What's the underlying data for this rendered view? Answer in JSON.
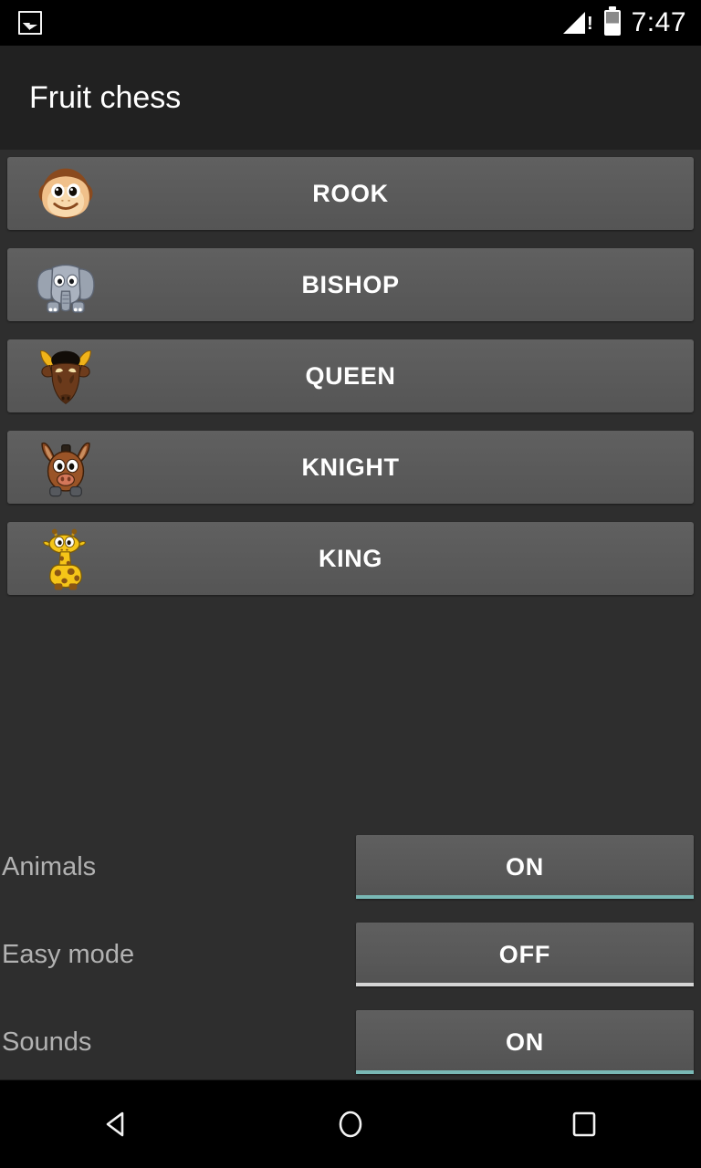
{
  "status_bar": {
    "notification_icon": "photo-icon",
    "signal_icon": "signal-no-sim-icon",
    "battery_icon": "battery-icon",
    "time": "7:47"
  },
  "header": {
    "title": "Fruit chess"
  },
  "pieces": [
    {
      "label": "ROOK",
      "icon": "monkey-icon"
    },
    {
      "label": "BISHOP",
      "icon": "elephant-icon"
    },
    {
      "label": "QUEEN",
      "icon": "bull-icon"
    },
    {
      "label": "KNIGHT",
      "icon": "horse-icon"
    },
    {
      "label": "KING",
      "icon": "giraffe-icon"
    }
  ],
  "settings": [
    {
      "label": "Animals",
      "value": "ON",
      "state": "on"
    },
    {
      "label": "Easy mode",
      "value": "OFF",
      "state": "off"
    },
    {
      "label": "Sounds",
      "value": "ON",
      "state": "on"
    }
  ],
  "nav_bar": {
    "back": "back-triangle-icon",
    "home": "home-circle-icon",
    "recents": "recents-square-icon"
  },
  "colors": {
    "background": "#2e2e2e",
    "header": "#212121",
    "button": "#5a5a5a",
    "accent_on": "#79b8b5",
    "accent_off": "#d5d5d5",
    "text_primary": "#ffffff",
    "text_secondary": "#b2b2b2"
  }
}
